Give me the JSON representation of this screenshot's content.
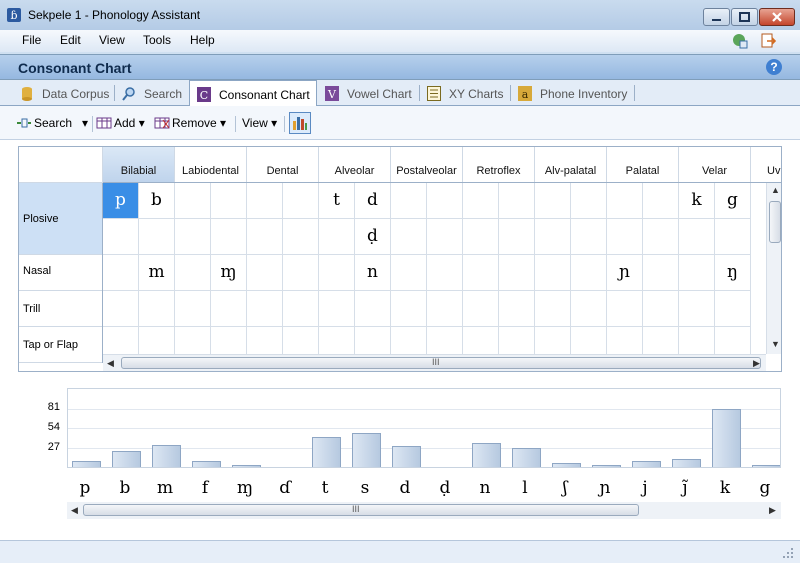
{
  "window": {
    "title": "Sekpele 1 - Phonology Assistant"
  },
  "menu": {
    "items": [
      "File",
      "Edit",
      "View",
      "Tools",
      "Help"
    ]
  },
  "view": {
    "title": "Consonant Chart",
    "help_glyph": "?"
  },
  "tabs": [
    {
      "label": "Data Corpus",
      "icon": "data-corpus-icon"
    },
    {
      "label": "Search",
      "icon": "search-icon"
    },
    {
      "label": "Consonant Chart",
      "icon": "consonant-chart-icon",
      "active": true
    },
    {
      "label": "Vowel Chart",
      "icon": "vowel-chart-icon"
    },
    {
      "label": "XY Charts",
      "icon": "xy-charts-icon"
    },
    {
      "label": "Phone Inventory",
      "icon": "phone-inventory-icon"
    }
  ],
  "toolbar": {
    "search_label": "Search",
    "add_label": "Add",
    "remove_label": "Remove",
    "view_label": "View"
  },
  "chart": {
    "columns": [
      "Bilabial",
      "Labiodental",
      "Dental",
      "Alveolar",
      "Postalveolar",
      "Retroflex",
      "Alv-palatal",
      "Palatal",
      "Velar",
      "Uv"
    ],
    "rows": [
      "Plosive",
      "",
      "Nasal",
      "Trill",
      "Tap or Flap"
    ],
    "cells": [
      [
        "p",
        "b",
        "",
        "",
        "",
        "",
        "t",
        "d",
        "",
        "",
        "",
        "",
        "",
        "",
        "",
        "",
        "k",
        "g"
      ],
      [
        "",
        "",
        "",
        "",
        "",
        "",
        "",
        "ḍ",
        "",
        "",
        "",
        "",
        "",
        "",
        "",
        "",
        "",
        ""
      ],
      [
        "",
        "m",
        "",
        "ɱ",
        "",
        "",
        "",
        "n",
        "",
        "",
        "",
        "",
        "",
        "",
        "ɲ",
        "",
        "",
        "ŋ"
      ],
      [
        "",
        "",
        "",
        "",
        "",
        "",
        "",
        "",
        "",
        "",
        "",
        "",
        "",
        "",
        "",
        "",
        "",
        ""
      ],
      [
        "",
        "",
        "",
        "",
        "",
        "",
        "",
        "",
        "",
        "",
        "",
        "",
        "",
        "",
        "",
        "",
        "",
        ""
      ]
    ],
    "scroll_grip": "III"
  },
  "histogram": {
    "ticks": [
      "81",
      "54",
      "27"
    ],
    "max": 81,
    "phones": [
      "p",
      "b",
      "m",
      "f",
      "ɱ",
      "ɗ",
      "t",
      "s",
      "d",
      "ḍ",
      "n",
      "l",
      "ʃ",
      "ɲ",
      "j",
      "j̃",
      "k",
      "g"
    ],
    "counts": [
      9,
      23,
      31,
      9,
      2,
      0,
      42,
      48,
      30,
      0,
      34,
      26,
      5,
      3,
      8,
      11,
      81,
      3
    ],
    "scroll_grip": "III"
  }
}
